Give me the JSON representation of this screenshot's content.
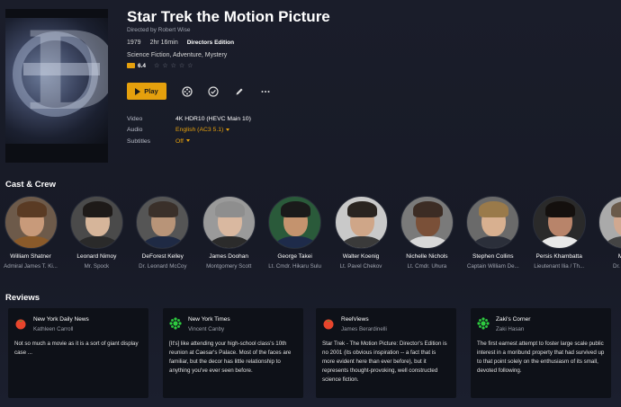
{
  "movie": {
    "title": "Star Trek the Motion Picture",
    "director": "Directed by Robert Wise",
    "year": "1979",
    "duration": "2hr 16min",
    "edition": "Directors Edition",
    "genres": "Science Fiction, Adventure, Mystery",
    "rating_value": "6.4",
    "user_stars": 0
  },
  "actions": {
    "play_label": "Play"
  },
  "info": [
    {
      "label": "Video",
      "value": "4K HDR10 (HEVC Main 10)",
      "dropdown": false
    },
    {
      "label": "Audio",
      "value": "English (AC3 5.1)",
      "dropdown": true
    },
    {
      "label": "Subtitles",
      "value": "Off",
      "dropdown": true
    }
  ],
  "sections": {
    "cast_title": "Cast & Crew",
    "reviews_title": "Reviews"
  },
  "cast": [
    {
      "name": "William Shatner",
      "role": "Admiral James T. Ki..."
    },
    {
      "name": "Leonard Nimoy",
      "role": "Mr. Spock"
    },
    {
      "name": "DeForest Kelley",
      "role": "Dr. Leonard McCoy"
    },
    {
      "name": "James Doohan",
      "role": "Montgomery Scott"
    },
    {
      "name": "George Takei",
      "role": "Lt. Cmdr. Hikaru Sulu"
    },
    {
      "name": "Walter Koenig",
      "role": "Lt. Pavel Chekov"
    },
    {
      "name": "Nichelle Nichols",
      "role": "Lt. Cmdr. Uhura"
    },
    {
      "name": "Stephen Collins",
      "role": "Captain William De..."
    },
    {
      "name": "Persis Khambatta",
      "role": "Lieutenant Ilia / Th..."
    },
    {
      "name": "Majel",
      "role": "Dr. Christi"
    }
  ],
  "reviews": [
    {
      "source": "New York Daily News",
      "author": "Kathleen Carroll",
      "icon": "tomato-icon",
      "text": "Not so much a movie as it is a sort of giant display case ..."
    },
    {
      "source": "New York Times",
      "author": "Vincent Canby",
      "icon": "splat-icon",
      "text": "[It's] like attending your high-school class's 10th reunion at Caesar's Palace. Most of the faces are familiar, but the decor has little relationship to anything you've ever seen before."
    },
    {
      "source": "ReelViews",
      "author": "James Berardinelli",
      "icon": "tomato-icon",
      "text": "Star Trek - The Motion Picture: Director's Edition is no 2001 (its obvious inspiration -- a fact that is more evident here than ever before), but it represents thought-provoking, well constructed science fiction."
    },
    {
      "source": "Zaki's Corner",
      "author": "Zaki Hasan",
      "icon": "splat-icon",
      "text": "The first earnest attempt to foster large scale public interest in a moribund property that had survived up to that point solely on the enthusiasm of its small, devoted following."
    }
  ],
  "colors": {
    "accent": "#e5a00d",
    "background": "#1a1d2a",
    "card": "#0e1118",
    "fresh": "#e8452c",
    "rotten": "#2ecc40"
  }
}
